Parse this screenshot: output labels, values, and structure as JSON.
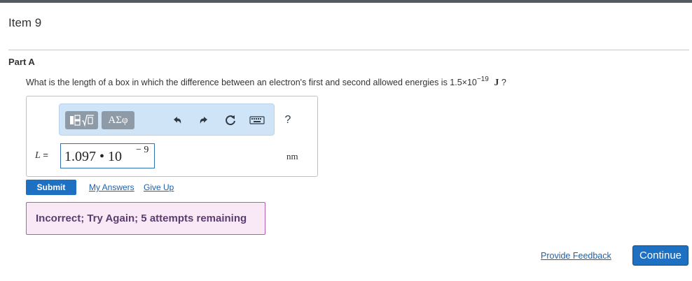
{
  "item": {
    "title": "Item 9"
  },
  "part": {
    "title": "Part A"
  },
  "question": {
    "text_before": "What is the length of a box in which the difference between an electron's first and second allowed energies is 1.5×10",
    "exponent": "−19",
    "unit": "J",
    "text_after": "?"
  },
  "toolbar": {
    "greek_label": "ΑΣφ",
    "help_label": "?"
  },
  "answer": {
    "variable": "L",
    "equals": "=",
    "value_main": "1.097 • 10",
    "value_exponent": "− 9",
    "unit": "nm"
  },
  "actions": {
    "submit_label": "Submit",
    "my_answers_label": "My Answers",
    "give_up_label": "Give Up"
  },
  "feedback": {
    "message": "Incorrect; Try Again; 5 attempts remaining"
  },
  "footer": {
    "provide_feedback_label": "Provide Feedback",
    "continue_label": "Continue"
  },
  "colors": {
    "primary_button": "#1e70c2",
    "toolbar_bg": "#d0e4f7",
    "feedback_bg": "#f9e9f7",
    "feedback_border": "#b45fae",
    "link": "#1e5fa8"
  }
}
